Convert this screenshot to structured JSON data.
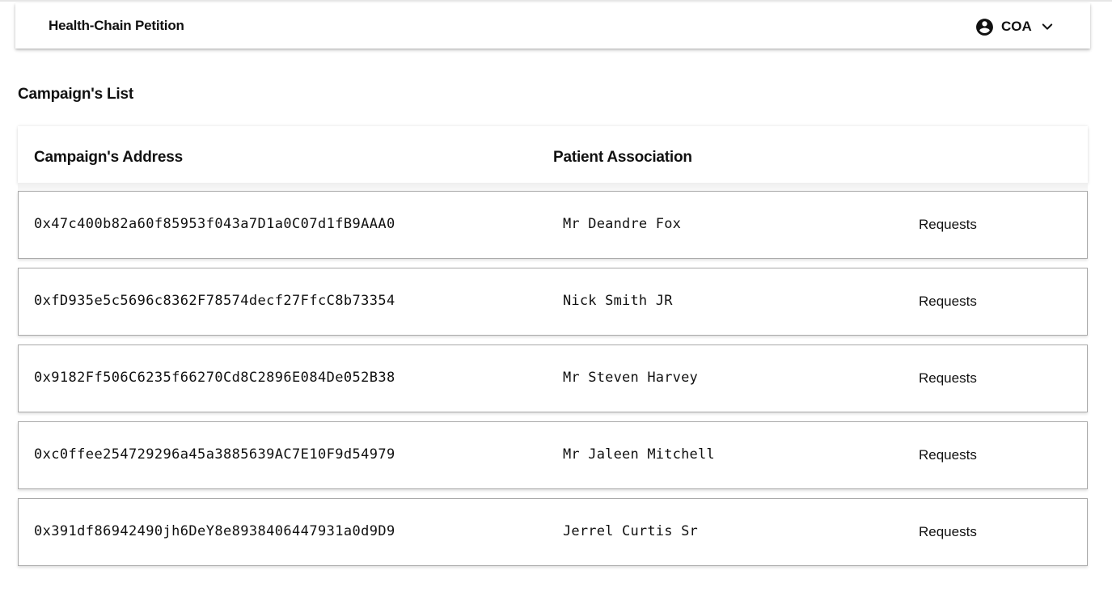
{
  "app": {
    "title": "Health-Chain Petition"
  },
  "user_menu": {
    "name": "COA",
    "avatar_icon": "account-circle-icon",
    "dropdown_icon": "chevron-down-icon"
  },
  "page": {
    "title": "Campaign's List"
  },
  "table": {
    "headers": {
      "address": "Campaign's Address",
      "association": "Patient Association"
    },
    "rows": [
      {
        "address": "0x47c400b82a60f85953f043a7D1a0C07d1fB9AAA0",
        "association": "Mr Deandre Fox",
        "action": "Requests"
      },
      {
        "address": "0xfD935e5c5696c8362F78574decf27FfcC8b73354",
        "association": "Nick Smith JR",
        "action": "Requests"
      },
      {
        "address": "0x9182Ff506C6235f66270Cd8C2896E084De052B38",
        "association": "Mr Steven Harvey",
        "action": "Requests"
      },
      {
        "address": "0xc0ffee254729296a45a3885639AC7E10F9d54979",
        "association": "Mr Jaleen Mitchell",
        "action": "Requests"
      },
      {
        "address": "0x391df86942490jh6DeY8e8938406447931a0d9D9",
        "association": "Jerrel Curtis Sr",
        "action": "Requests"
      }
    ]
  },
  "colors": {
    "text": "#111111",
    "row_border": "#a9a9a9",
    "background": "#ffffff"
  }
}
